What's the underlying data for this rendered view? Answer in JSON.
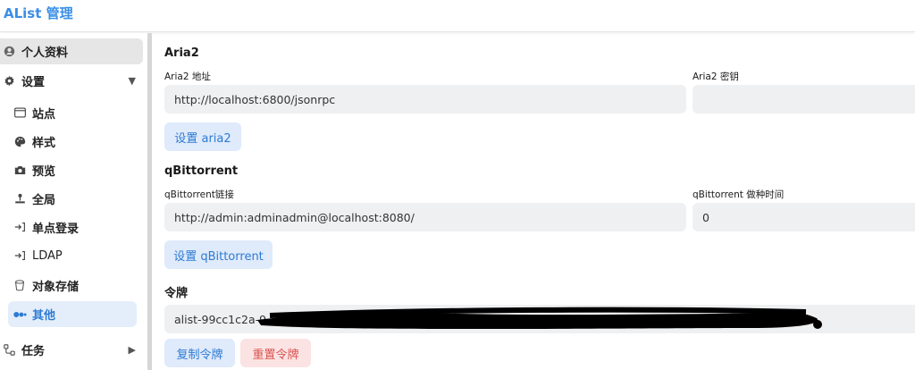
{
  "app": {
    "title": "AList 管理"
  },
  "sidebar": {
    "profile": {
      "label": "个人资料",
      "icon": "user-circle-icon"
    },
    "settings": {
      "label": "设置",
      "icon": "gear-icon",
      "expanded": true
    },
    "items": [
      {
        "label": "站点",
        "icon": "window-icon"
      },
      {
        "label": "样式",
        "icon": "palette-icon"
      },
      {
        "label": "预览",
        "icon": "camera-icon"
      },
      {
        "label": "全局",
        "icon": "joystick-icon"
      },
      {
        "label": "单点登录",
        "icon": "login-arrow-icon"
      },
      {
        "label": "LDAP",
        "icon": "login-arrow-icon"
      },
      {
        "label": "对象存储",
        "icon": "bucket-icon"
      },
      {
        "label": "其他",
        "icon": "dots-icon",
        "active": true
      }
    ],
    "tasks": {
      "label": "任务",
      "icon": "flow-icon"
    }
  },
  "aria2": {
    "title": "Aria2",
    "address_label": "Aria2 地址",
    "address_value": "http://localhost:6800/jsonrpc",
    "secret_label": "Aria2 密钥",
    "secret_value": "",
    "button": "设置 aria2"
  },
  "qbittorrent": {
    "title": "qBittorrent",
    "url_label": "qBittorrent链接",
    "url_value": "http://admin:adminadmin@localhost:8080/",
    "seedtime_label": "qBittorrent 做种时间",
    "seedtime_value": "0",
    "button": "设置 qBittorrent"
  },
  "token": {
    "title": "令牌",
    "value": "alist-99cc1c2a-9",
    "copy_button": "复制令牌",
    "reset_button": "重置令牌"
  },
  "colors": {
    "accent": "#2d7bd3",
    "danger": "#d9534f",
    "field_bg": "#eff0f2"
  }
}
